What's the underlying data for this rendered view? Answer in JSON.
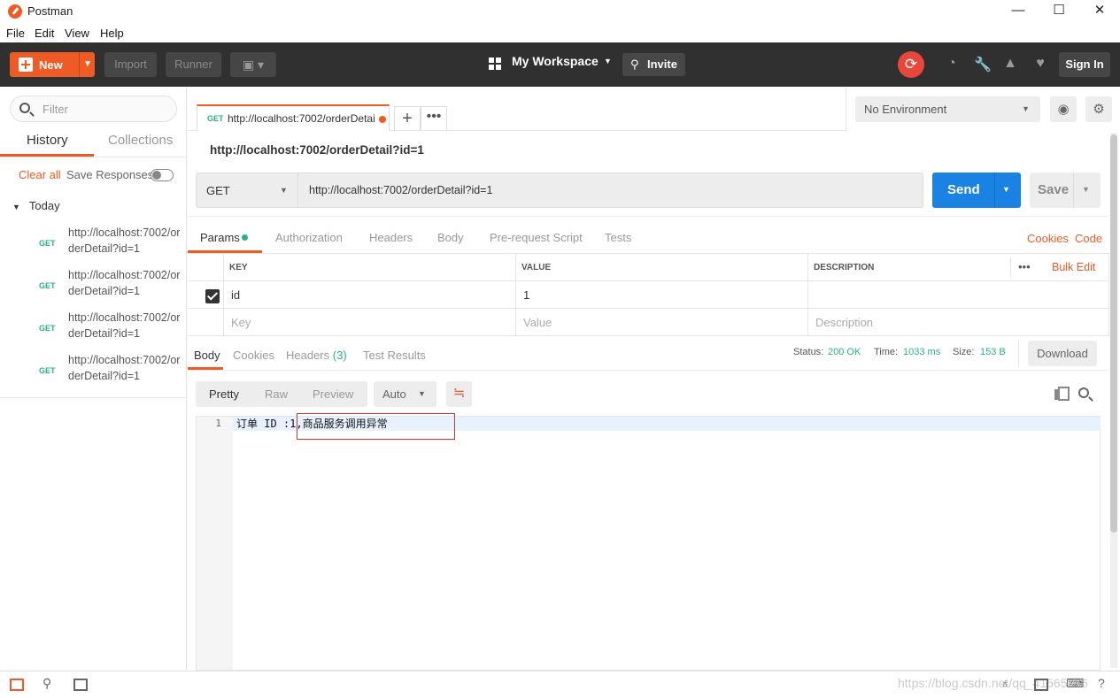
{
  "window": {
    "title": "Postman",
    "controls": [
      "—",
      "☐",
      "✕"
    ]
  },
  "menu": [
    "File",
    "Edit",
    "View",
    "Help"
  ],
  "toolbar": {
    "new_label": "New",
    "import_label": "Import",
    "runner_label": "Runner",
    "workspace_label": "My Workspace",
    "invite_label": "Invite",
    "signin_label": "Sign In",
    "icons": [
      "sync-icon",
      "satellite-icon",
      "wrench-icon",
      "bell-icon",
      "heart-icon"
    ]
  },
  "sidebar": {
    "filter_placeholder": "Filter",
    "tabs": [
      "History",
      "Collections"
    ],
    "clear_all": "Clear all",
    "save_responses": "Save Responses",
    "group": "Today",
    "items": [
      {
        "method": "GET",
        "url": "http://localhost:7002/orderDetail?id=1"
      },
      {
        "method": "GET",
        "url": "http://localhost:7002/orderDetail?id=1"
      },
      {
        "method": "GET",
        "url": "http://localhost:7002/orderDetail?id=1"
      },
      {
        "method": "GET",
        "url": "http://localhost:7002/orderDetail?id=1"
      }
    ]
  },
  "request_tab": {
    "method": "GET",
    "title": "http://localhost:7002/orderDetai"
  },
  "environment": {
    "selected": "No Environment"
  },
  "request": {
    "name": "http://localhost:7002/orderDetail?id=1",
    "method": "GET",
    "url": "http://localhost:7002/orderDetail?id=1",
    "send_label": "Send",
    "save_label": "Save",
    "tabs": [
      "Params",
      "Authorization",
      "Headers",
      "Body",
      "Pre-request Script",
      "Tests"
    ],
    "cookies_link": "Cookies",
    "code_link": "Code"
  },
  "params": {
    "headers": [
      "KEY",
      "VALUE",
      "DESCRIPTION"
    ],
    "bulk_edit": "Bulk Edit",
    "rows": [
      {
        "key": "id",
        "value": "1",
        "description": ""
      }
    ],
    "placeholder": {
      "key": "Key",
      "value": "Value",
      "description": "Description"
    }
  },
  "response": {
    "tabs": [
      "Body",
      "Cookies",
      "Headers",
      "Test Results"
    ],
    "headers_count": "(3)",
    "status_label": "Status:",
    "status_value": "200 OK",
    "time_label": "Time:",
    "time_value": "1033 ms",
    "size_label": "Size:",
    "size_value": "153 B",
    "download_label": "Download",
    "formats": [
      "Pretty",
      "Raw",
      "Preview"
    ],
    "format_select": "Auto",
    "body_lines": [
      {
        "no": "1",
        "text": "订单 ID :1,商品服务调用异常"
      }
    ]
  },
  "statusbar": {
    "watermark": "https://blog.csdn.net/qq_41565786"
  }
}
